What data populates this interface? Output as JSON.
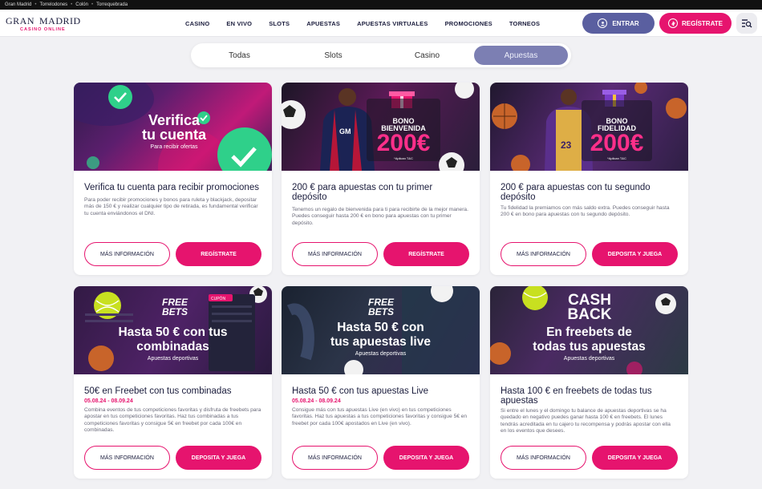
{
  "topbar": {
    "links": [
      "Gran Madrid",
      "Torrelodones",
      "Colón",
      "Torrequebrada"
    ]
  },
  "logo": {
    "left": "GRAN",
    "right": "MADRID",
    "sub": "CASINO ONLINE"
  },
  "nav": [
    "CASINO",
    "EN VIVO",
    "SLOTS",
    "APUESTAS",
    "APUESTAS VIRTUALES",
    "PROMOCIONES",
    "TORNEOS"
  ],
  "header": {
    "login_label": "ENTRAR",
    "register_label": "REGÍSTRATE"
  },
  "tabs": [
    {
      "label": "Todas",
      "active": false
    },
    {
      "label": "Slots",
      "active": false
    },
    {
      "label": "Casino",
      "active": false
    },
    {
      "label": "Apuestas",
      "active": true
    }
  ],
  "cards": [
    {
      "banner": {
        "headline1": "Verifica",
        "headline2": "tu cuenta",
        "sub": "Para recibir ofertas"
      },
      "title": "Verifica tu cuenta para recibir promociones",
      "date": "",
      "desc": "Para poder recibir promociones y bonos para ruleta y blackjack, depositar más de 150 € y realizar cualquier tipo de retirada, es fundamental verificar tu cuenta enviándonos el DNI.",
      "btn_info": "MÁS INFORMACIÓN",
      "btn_main": "REGÍSTRATE"
    },
    {
      "banner": {
        "label1": "BONO",
        "label2": "BIENVENIDA",
        "amount": "200€",
        "note": "*Aplican T&C"
      },
      "title": "200 € para apuestas con tu primer depósito",
      "date": "",
      "desc": "Tenemos un regalo de bienvenida para ti para recibirte de la mejor manera. Puedes conseguir hasta 200 € en bono para apuestas con tu primer depósito.",
      "btn_info": "MÁS INFORMACIÓN",
      "btn_main": "REGÍSTRATE"
    },
    {
      "banner": {
        "label1": "BONO",
        "label2": "FIDELIDAD",
        "amount": "200€",
        "note": "*Aplican T&C"
      },
      "title": "200 € para apuestas con tu segundo depósito",
      "date": "",
      "desc": "Tu fidelidad la premiamos con más saldo extra. Puedes conseguir hasta 200 € en bono para apuestas con tu segundo depósito.",
      "btn_info": "MÁS INFORMACIÓN",
      "btn_main": "DEPOSITA Y JUEGA"
    },
    {
      "banner": {
        "top1": "FREE",
        "top2": "BETS",
        "headline1": "Hasta 50 € con tus",
        "headline2": "combinadas",
        "sub": "Apuestas deportivas"
      },
      "title": "50€ en Freebet con tus combinadas",
      "date": "05.08.24 - 08.09.24",
      "desc": "Combina eventos de tus competiciones favoritas y disfruta de freebets para apostar en tus competiciones favoritas. Haz tus combinadas a tus competiciones favoritas y consigue 5€ en freebet por cada 100€ en combinadas.",
      "btn_info": "MÁS INFORMACIÓN",
      "btn_main": "DEPOSITA Y JUEGA"
    },
    {
      "banner": {
        "top1": "FREE",
        "top2": "BETS",
        "headline1": "Hasta 50 € con",
        "headline2": "tus apuestas live",
        "sub": "Apuestas deportivas"
      },
      "title": "Hasta 50 € con tus apuestas Live",
      "date": "05.08.24 - 08.09.24",
      "desc": "Consigue más con tus apuestas Live (en vivo) en tus competiciones favoritas. Haz tus apuestas a tus competiciones favoritas y consigue 5€ en freebet por cada 100€ apostados en Live (en vivo).",
      "btn_info": "MÁS INFORMACIÓN",
      "btn_main": "DEPOSITA Y JUEGA"
    },
    {
      "banner": {
        "top1": "CASH",
        "top2": "BACK",
        "headline1": "En freebets de",
        "headline2": "todas tus apuestas",
        "sub": "Apuestas deportivas"
      },
      "title": "Hasta 100 € en freebets de todas tus apuestas",
      "date": "",
      "desc": "Si entre el lunes y el domingo tu balance de apuestas deportivas se ha quedado en negativo puedes ganar hasta 100 € en freebets. El lunes tendrás acreditada en tu cajero tu recompensa y podrás apostar con ella en los eventos que desees.",
      "btn_info": "MÁS INFORMACIÓN",
      "btn_main": "DEPOSITA Y JUEGA"
    }
  ]
}
